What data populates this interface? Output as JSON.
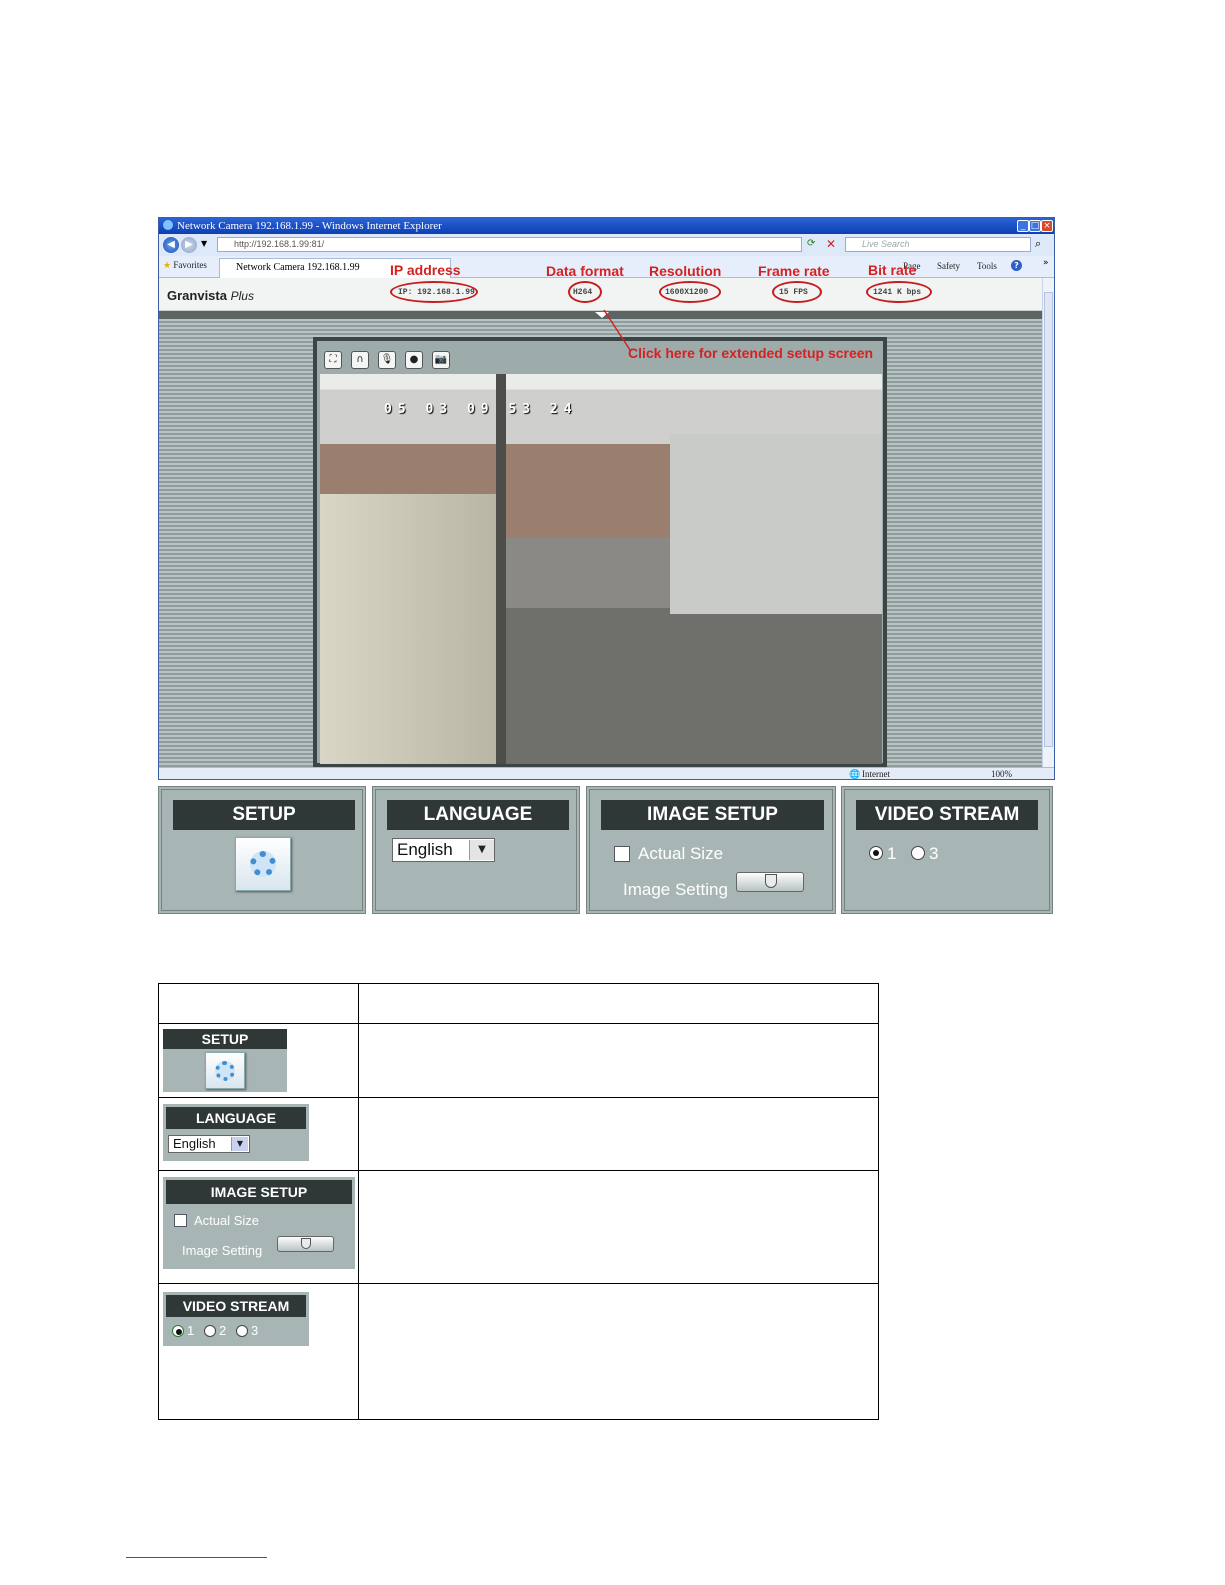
{
  "browser": {
    "title": "Network Camera 192.168.1.99 - Windows Internet Explorer",
    "url": "http://192.168.1.99:81/",
    "search_placeholder": "Live Search",
    "favorites_label": "Favorites",
    "tab_label": "Network Camera 192.168.1.99",
    "commands": [
      "Page",
      "Safety",
      "Tools"
    ],
    "status_zone": "Internet",
    "zoom": "100%"
  },
  "page": {
    "brand": "Granvista",
    "brand_suffix": "Plus",
    "status": {
      "ip": "IP: 192.168.1.99",
      "format": "H264",
      "resolution": "1600X1200",
      "frame_rate": "15 FPS",
      "bit_rate": "1241 K bps"
    },
    "video_timestamp": "05 03 09 53 24"
  },
  "annotations": {
    "ip": "IP address",
    "format": "Data format",
    "resolution": "Resolution",
    "frame_rate": "Frame rate",
    "bit_rate": "Bit rate",
    "setup_hint": "Click here for extended setup screen"
  },
  "panels": {
    "setup": {
      "title": "SETUP"
    },
    "language": {
      "title": "LANGUAGE",
      "selected": "English"
    },
    "image_setup": {
      "title": "IMAGE SETUP",
      "actual_size": "Actual Size",
      "image_setting": "Image Setting"
    },
    "video_stream": {
      "title": "VIDEO STREAM",
      "options": [
        "1",
        "3"
      ],
      "selected": "1"
    }
  },
  "table": {
    "rows": [
      {
        "title": "SETUP"
      },
      {
        "title": "LANGUAGE",
        "selected": "English"
      },
      {
        "title": "IMAGE SETUP",
        "actual_size": "Actual Size",
        "image_setting": "Image Setting"
      },
      {
        "title": "VIDEO STREAM",
        "options": [
          "1",
          "2",
          "3"
        ],
        "selected": "1"
      }
    ]
  },
  "colors": {
    "panel_bg": "#a7b5b5",
    "panel_title_bg": "#2f3737",
    "annotation": "#d42222"
  }
}
